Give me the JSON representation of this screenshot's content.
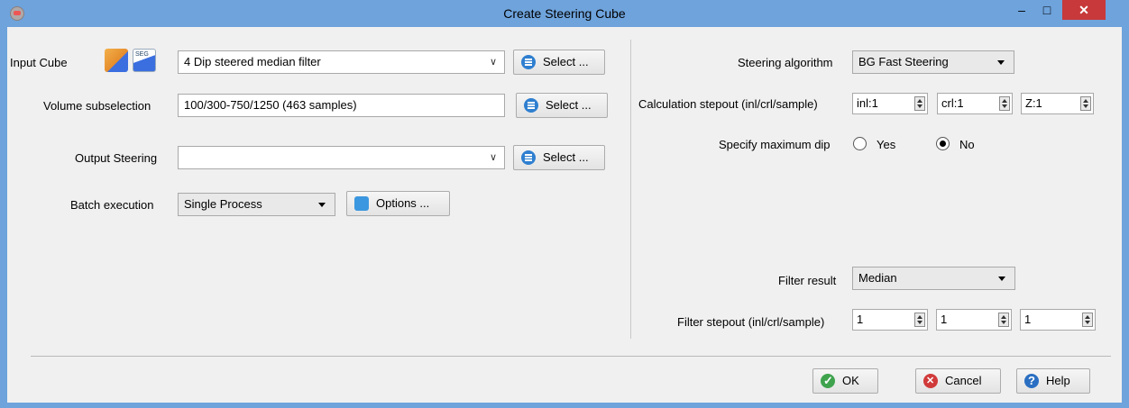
{
  "window": {
    "title": "Create Steering Cube",
    "minimize": "–",
    "maximize": "□",
    "close": "✕"
  },
  "left": {
    "input_cube_label": "Input Cube",
    "input_cube_value": "4 Dip steered median filter",
    "input_select": "Select ...",
    "volume_label": "Volume subselection",
    "volume_value": "100/300-750/1250 (463 samples)",
    "volume_select": "Select ...",
    "output_label": "Output Steering",
    "output_value": "",
    "output_select": "Select ...",
    "batch_label": "Batch execution",
    "batch_value": "Single Process",
    "options_button": "Options ..."
  },
  "right": {
    "algorithm_label": "Steering algorithm",
    "algorithm_value": "BG Fast Steering",
    "stepout_label": "Calculation stepout (inl/crl/sample)",
    "stepout_inl": "inl:1",
    "stepout_crl": "crl:1",
    "stepout_z": "Z:1",
    "maxdip_label": "Specify maximum dip",
    "maxdip_yes": "Yes",
    "maxdip_no": "No",
    "maxdip_selected": "No",
    "filter_label": "Filter result",
    "filter_value": "Median",
    "filter_stepout_label": "Filter stepout (inl/crl/sample)",
    "filter_inl": "1",
    "filter_crl": "1",
    "filter_sample": "1"
  },
  "footer": {
    "ok": "OK",
    "cancel": "Cancel",
    "help": "Help"
  },
  "colors": {
    "titlebar": "#6ea3dc",
    "close": "#c7393a",
    "client": "#f0f0f0"
  }
}
